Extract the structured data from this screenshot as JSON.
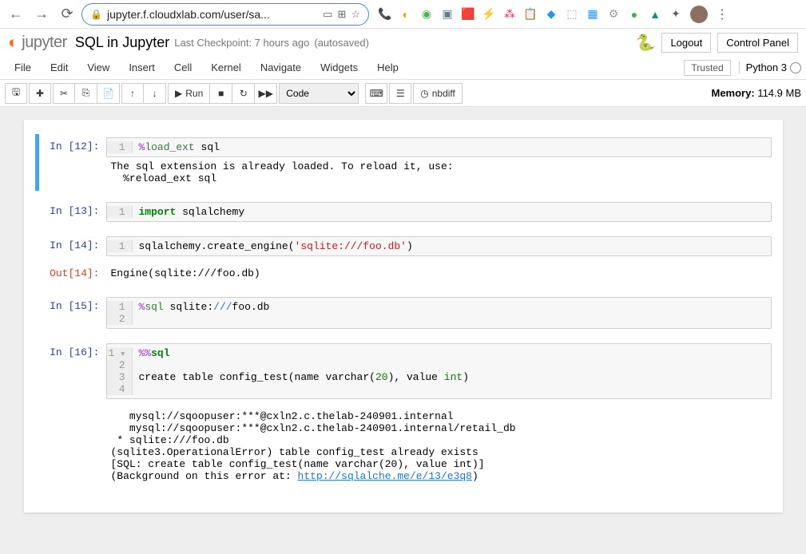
{
  "browser": {
    "url": "jupyter.f.cloudxlab.com/user/sa..."
  },
  "header": {
    "logo_text": "jupyter",
    "notebook_name": "SQL in Jupyter",
    "checkpoint": "Last Checkpoint: 7 hours ago",
    "autosave": "(autosaved)",
    "logout": "Logout",
    "control_panel": "Control Panel"
  },
  "menu": {
    "items": [
      "File",
      "Edit",
      "View",
      "Insert",
      "Cell",
      "Kernel",
      "Navigate",
      "Widgets",
      "Help"
    ],
    "trusted": "Trusted",
    "kernel": "Python 3"
  },
  "toolbar": {
    "run": "Run",
    "cell_type": "Code",
    "nbdiff": "nbdiff",
    "memory_label": "Memory:",
    "memory_value": "114.9 MB"
  },
  "cells": [
    {
      "in_prompt": "In [12]:",
      "lines": [
        {
          "n": "1",
          "html": "<span class='cm-operator'>%</span><span class='cm-magic'>load_ext</span> sql"
        }
      ],
      "output_text": "The sql extension is already loaded. To reload it, use:\n  %reload_ext sql"
    },
    {
      "in_prompt": "In [13]:",
      "lines": [
        {
          "n": "1",
          "html": "<span class='cm-keyword'>import</span> sqlalchemy"
        }
      ]
    },
    {
      "in_prompt": "In [14]:",
      "lines": [
        {
          "n": "1",
          "html": "sqlalchemy.create_engine(<span class='cm-string'>'sqlite:///foo.db'</span>)"
        }
      ],
      "out_prompt": "Out[14]:",
      "output_text": "Engine(sqlite:///foo.db)"
    },
    {
      "in_prompt": "In [15]:",
      "lines": [
        {
          "n": "1",
          "html": "<span class='cm-operator'>%</span><span class='cm-magic'>sql</span> sqlite:<span class='cm-path'>///</span>foo.db"
        },
        {
          "n": "2",
          "html": ""
        }
      ]
    },
    {
      "in_prompt": "In [16]:",
      "lines": [
        {
          "n": "1 <span class='fold-marker'>▼</span>",
          "html": "<span class='cm-operator'>%%</span><span class='cm-keyword'>sql</span>"
        },
        {
          "n": "2",
          "html": ""
        },
        {
          "n": "3",
          "html": "create table config_test(name varchar(<span class='cm-number'>20</span>), value <span class='cm-builtin'>int</span>)"
        },
        {
          "n": "4",
          "html": ""
        }
      ],
      "output_html": "   mysql://sqoopuser:***@cxln2.c.thelab-240901.internal\n   mysql://sqoopuser:***@cxln2.c.thelab-240901.internal/retail_db\n * sqlite:///foo.db\n(sqlite3.OperationalError) table config_test already exists\n[SQL: create table config_test(name varchar(20), value int)]\n(Background on this error at: <a href='#'>http://sqlalche.me/e/13/e3q8</a>)"
    }
  ]
}
